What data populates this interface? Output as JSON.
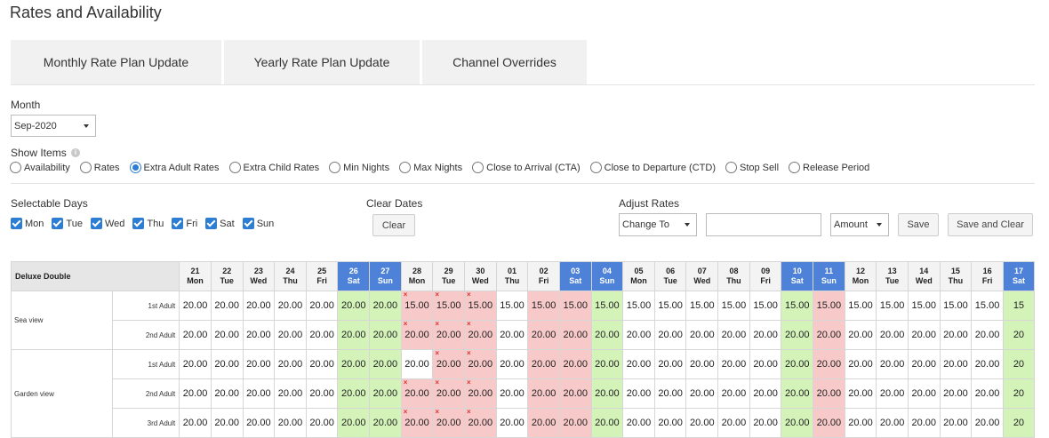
{
  "page_title": "Rates and Availability",
  "tabs": [
    {
      "label": "Monthly Rate Plan Update"
    },
    {
      "label": "Yearly Rate Plan Update"
    },
    {
      "label": "Channel Overrides"
    }
  ],
  "month": {
    "label": "Month",
    "value": "Sep-2020"
  },
  "show_items": {
    "label": "Show Items",
    "options": [
      "Availability",
      "Rates",
      "Extra Adult Rates",
      "Extra Child Rates",
      "Min Nights",
      "Max Nights",
      "Close to Arrival (CTA)",
      "Close to Departure (CTD)",
      "Stop Sell",
      "Release Period"
    ],
    "selected": "Extra Adult Rates"
  },
  "selectable_days": {
    "label": "Selectable Days",
    "days": [
      "Mon",
      "Tue",
      "Wed",
      "Thu",
      "Fri",
      "Sat",
      "Sun"
    ]
  },
  "clear_dates": {
    "label": "Clear Dates",
    "button": "Clear"
  },
  "adjust_rates": {
    "label": "Adjust Rates",
    "mode": "Change To",
    "value_placeholder": "",
    "unit": "Amount",
    "save": "Save",
    "save_and_clear": "Save and Clear"
  },
  "grid": {
    "room_type": "Deluxe Double",
    "dates": [
      {
        "day": "21",
        "dow": "Mon"
      },
      {
        "day": "22",
        "dow": "Tue"
      },
      {
        "day": "23",
        "dow": "Wed"
      },
      {
        "day": "24",
        "dow": "Thu"
      },
      {
        "day": "25",
        "dow": "Fri"
      },
      {
        "day": "26",
        "dow": "Sat"
      },
      {
        "day": "27",
        "dow": "Sun"
      },
      {
        "day": "28",
        "dow": "Mon"
      },
      {
        "day": "29",
        "dow": "Tue"
      },
      {
        "day": "30",
        "dow": "Wed"
      },
      {
        "day": "01",
        "dow": "Thu"
      },
      {
        "day": "02",
        "dow": "Fri"
      },
      {
        "day": "03",
        "dow": "Sat"
      },
      {
        "day": "04",
        "dow": "Sun"
      },
      {
        "day": "05",
        "dow": "Mon"
      },
      {
        "day": "06",
        "dow": "Tue"
      },
      {
        "day": "07",
        "dow": "Wed"
      },
      {
        "day": "08",
        "dow": "Thu"
      },
      {
        "day": "09",
        "dow": "Fri"
      },
      {
        "day": "10",
        "dow": "Sat"
      },
      {
        "day": "11",
        "dow": "Sun"
      },
      {
        "day": "12",
        "dow": "Mon"
      },
      {
        "day": "13",
        "dow": "Tue"
      },
      {
        "day": "14",
        "dow": "Wed"
      },
      {
        "day": "15",
        "dow": "Thu"
      },
      {
        "day": "16",
        "dow": "Fri"
      },
      {
        "day": "17",
        "dow": "Sat"
      }
    ],
    "weekend_columns": [
      5,
      6,
      12,
      13,
      19,
      20,
      26
    ],
    "header_highlight_columns": [
      5,
      6,
      12,
      13,
      19,
      20,
      26
    ],
    "closed_columns_by_row": {
      "0": [
        7,
        8,
        9,
        11,
        12,
        20
      ],
      "1": [
        7,
        8,
        9,
        11,
        12,
        20
      ],
      "2": [
        8,
        9,
        11,
        12,
        20
      ],
      "3": [
        7,
        8,
        9,
        11,
        12,
        20
      ],
      "4": [
        7,
        8,
        9,
        11,
        12,
        20
      ]
    },
    "stop_sell_marks_by_row": {
      "0": [
        7,
        8,
        9
      ],
      "1": [
        7,
        8,
        9
      ],
      "2": [
        8,
        9
      ],
      "3": [
        7,
        8,
        9
      ],
      "4": [
        7,
        8,
        9
      ]
    },
    "rooms": [
      {
        "name": "Sea view",
        "rows": [
          {
            "label": "1st Adult",
            "values": [
              "20.00",
              "20.00",
              "20.00",
              "20.00",
              "20.00",
              "20.00",
              "20.00",
              "15.00",
              "15.00",
              "15.00",
              "15.00",
              "15.00",
              "15.00",
              "15.00",
              "15.00",
              "15.00",
              "15.00",
              "15.00",
              "15.00",
              "15.00",
              "15.00",
              "15.00",
              "15.00",
              "15.00",
              "15.00",
              "15.00",
              "15"
            ]
          },
          {
            "label": "2nd Adult",
            "values": [
              "20.00",
              "20.00",
              "20.00",
              "20.00",
              "20.00",
              "20.00",
              "20.00",
              "20.00",
              "20.00",
              "20.00",
              "20.00",
              "20.00",
              "20.00",
              "20.00",
              "20.00",
              "20.00",
              "20.00",
              "20.00",
              "20.00",
              "20.00",
              "20.00",
              "20.00",
              "20.00",
              "20.00",
              "20.00",
              "20.00",
              "20"
            ]
          }
        ]
      },
      {
        "name": "Garden view",
        "rows": [
          {
            "label": "1st Adult",
            "values": [
              "20.00",
              "20.00",
              "20.00",
              "20.00",
              "20.00",
              "20.00",
              "20.00",
              "20.00",
              "20.00",
              "20.00",
              "20.00",
              "20.00",
              "20.00",
              "20.00",
              "20.00",
              "20.00",
              "20.00",
              "20.00",
              "20.00",
              "20.00",
              "20.00",
              "20.00",
              "20.00",
              "20.00",
              "20.00",
              "20.00",
              "20"
            ]
          },
          {
            "label": "2nd Adult",
            "values": [
              "20.00",
              "20.00",
              "20.00",
              "20.00",
              "20.00",
              "20.00",
              "20.00",
              "20.00",
              "20.00",
              "20.00",
              "20.00",
              "20.00",
              "20.00",
              "20.00",
              "20.00",
              "20.00",
              "20.00",
              "20.00",
              "20.00",
              "20.00",
              "20.00",
              "20.00",
              "20.00",
              "20.00",
              "20.00",
              "20.00",
              "20"
            ]
          },
          {
            "label": "3rd Adult",
            "values": [
              "20.00",
              "20.00",
              "20.00",
              "20.00",
              "20.00",
              "20.00",
              "20.00",
              "20.00",
              "20.00",
              "20.00",
              "20.00",
              "20.00",
              "20.00",
              "20.00",
              "20.00",
              "20.00",
              "20.00",
              "20.00",
              "20.00",
              "20.00",
              "20.00",
              "20.00",
              "20.00",
              "20.00",
              "20.00",
              "20.00",
              "20"
            ]
          }
        ]
      }
    ],
    "closed_mark": "×"
  }
}
